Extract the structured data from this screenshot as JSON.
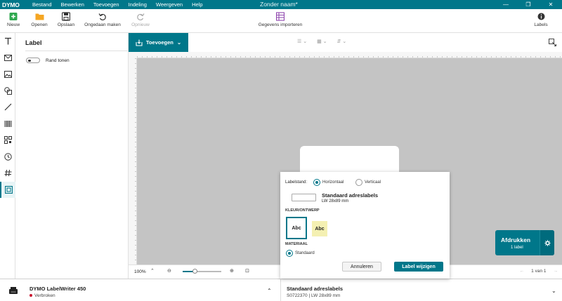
{
  "app": {
    "logo": "DYMO",
    "doc_title": "Zonder naam*",
    "menu": [
      "Bestand",
      "Bewerken",
      "Toevoegen",
      "Indeling",
      "Weergeven",
      "Help"
    ],
    "window_controls": {
      "minimize": "—",
      "restore": "❐",
      "close": "✕"
    }
  },
  "toolbar": {
    "new": "Nieuw",
    "open": "Openen",
    "save": "Opslaan",
    "undo": "Ongedaan maken",
    "redo": "Opnieuw",
    "import": "Gegevens importeren",
    "labels": "Labels"
  },
  "panel": {
    "title": "Label",
    "toggle_label": "Rand tonen"
  },
  "canvas": {
    "add_button": "Toevoegen",
    "zoom": "100%",
    "zoom_level": 0.3,
    "page": "1 van 1"
  },
  "print": {
    "label": "Afdrukken",
    "count": "1 label"
  },
  "status": {
    "printer_name": "DYMO LabelWriter 450",
    "printer_state": "Verbroken",
    "label_name": "Standaard adreslabels",
    "label_code": "S0722370  |  LW 28x89 mm"
  },
  "dialog": {
    "orientation_label": "Labelstand:",
    "horizontal": "Horizontaal",
    "vertical": "Verticaal",
    "label_name": "Standaard adreslabels",
    "label_size": "LW 28x89 mm",
    "color_section": "KLEUR/ONTWERP",
    "design_1": "Abc",
    "design_2": "Abc",
    "material_section": "MATERIAAL",
    "material_option": "Standaard",
    "cancel": "Annuleren",
    "confirm": "Label wijzigen"
  },
  "colors": {
    "accent": "#00778a",
    "status_red": "#c8102e",
    "design_yellow": "#f4f0b2"
  }
}
